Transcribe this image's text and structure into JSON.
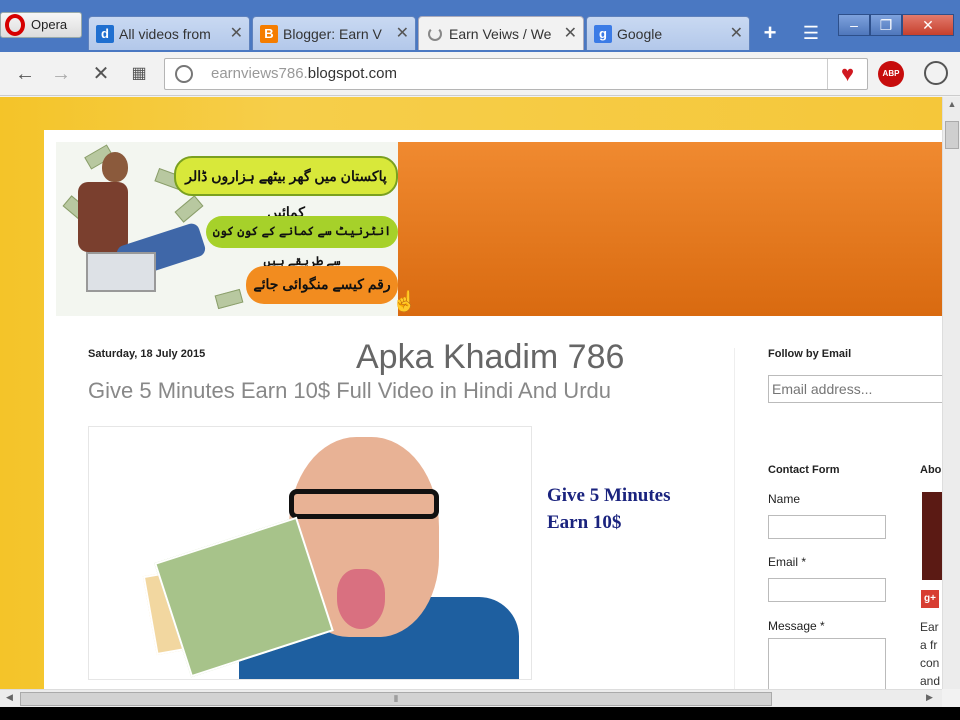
{
  "browser": {
    "opera_label": "Opera",
    "tabs": [
      {
        "title": "All videos from",
        "favicon": "d"
      },
      {
        "title": "Blogger: Earn V",
        "favicon": "B"
      },
      {
        "title": "Earn Veiws / We",
        "favicon": ""
      },
      {
        "title": "Google",
        "favicon": "g"
      }
    ],
    "close_glyph": "✕",
    "new_tab_glyph": "+",
    "url_prefix": "earnviews786.",
    "url_host": "blogspot.com",
    "abp_label": "ABP"
  },
  "page": {
    "banner": {
      "urdu_line1": "پاکستان میں گھر بیٹھے ہزاروں ڈالر کمائیں",
      "urdu_line2": "انٹرنیٹ سے کمانے کے کون کون سے طریقے ہیں",
      "urdu_line3": "رقم کیسے منگوائی جائے"
    },
    "post_date": "Saturday, 18 July 2015",
    "blog_title": "Apka Khadim 786",
    "post_title": "Give 5 Minutes Earn 10$ Full Video in Hindi And Urdu",
    "caption_line1": "Give 5 Minutes",
    "caption_line2": "Earn 10$",
    "sidebar": {
      "follow_heading": "Follow by Email",
      "email_placeholder": "Email address...",
      "contact_heading": "Contact Form",
      "name_label": "Name",
      "email_label": "Email *",
      "message_label": "Message *",
      "about_heading": "Abo",
      "gplus_label": "g+",
      "about_lines": [
        "Ear",
        "a fr",
        "con",
        "and"
      ]
    }
  },
  "colors": {
    "tabstrip": "#4a78c2",
    "page_background": "#f4c429",
    "banner_orange": "#e67a20",
    "caption_blue": "#1a237e"
  }
}
